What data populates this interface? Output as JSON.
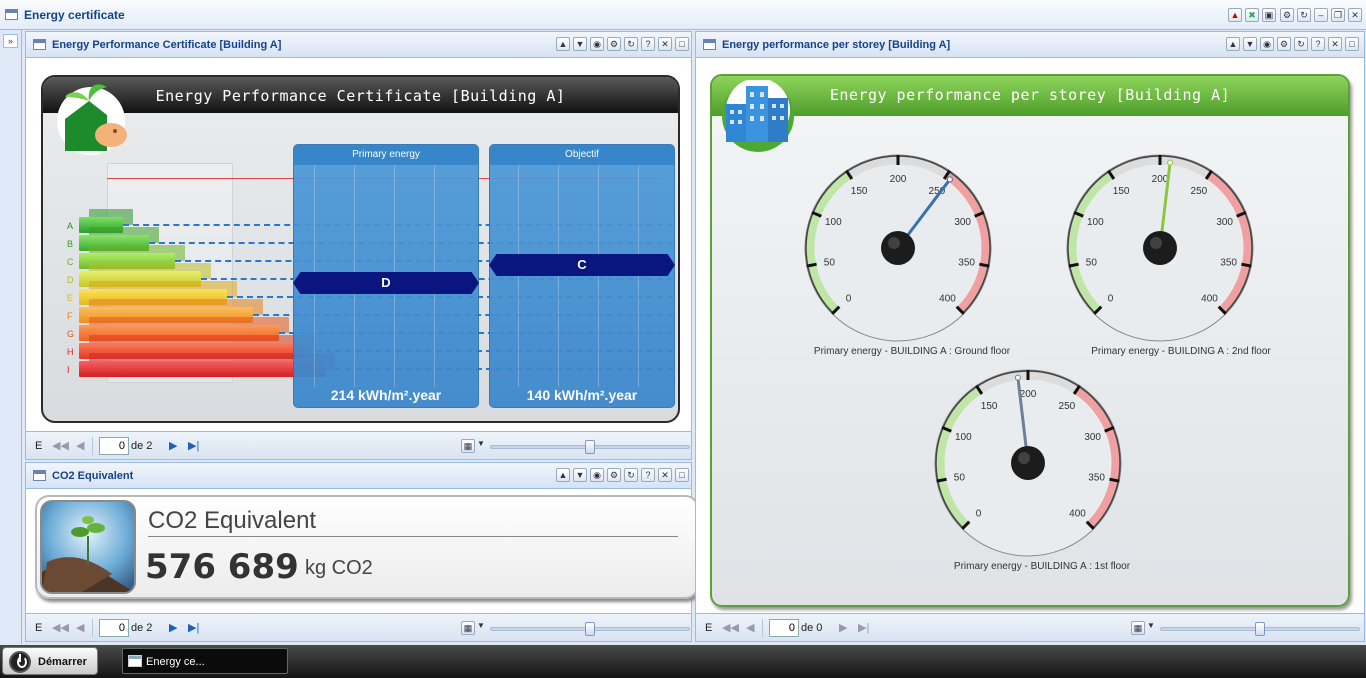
{
  "window": {
    "title": "Energy certificate"
  },
  "panels": {
    "epc": {
      "header": "Energy Performance Certificate [Building A]",
      "chart_title": "Energy Performance Certificate [Building A]",
      "letters": [
        "A",
        "B",
        "C",
        "D",
        "E",
        "F",
        "G",
        "H",
        "I"
      ],
      "columns": [
        {
          "header": "Primary energy",
          "rating": "D",
          "value": "214 kWh/m².year"
        },
        {
          "header": "Objectif",
          "rating": "C",
          "value": "140 kWh/m².year"
        }
      ],
      "footer": {
        "prefix": "E",
        "page": "0",
        "of": "de 2"
      }
    },
    "co2": {
      "header": "CO2 Equivalent",
      "label": "CO2 Equivalent",
      "value": "576 689",
      "unit": "kg CO2",
      "footer": {
        "prefix": "E",
        "page": "0",
        "of": "de 2"
      }
    },
    "storey": {
      "header": "Energy performance per storey [Building A]",
      "chart_title": "Energy performance per storey [Building A]",
      "gauge_ticks": [
        "0",
        "50",
        "100",
        "150",
        "200",
        "250",
        "300",
        "350",
        "400"
      ],
      "gauges": [
        {
          "caption": "Primary energy - BUILDING A : Ground floor",
          "value": 255,
          "needle_color": "#3a6fb0"
        },
        {
          "caption": "Primary energy - BUILDING A : 2nd floor",
          "value": 210,
          "needle_color": "#8cc63f"
        },
        {
          "caption": "Primary energy - BUILDING A : 1st floor",
          "value": 190,
          "needle_color": "#6f7f99"
        }
      ],
      "footer": {
        "prefix": "E",
        "page": "0",
        "of": "de 0"
      }
    }
  },
  "taskbar": {
    "start_label": "Démarrer",
    "task_label": "Energy ce..."
  }
}
